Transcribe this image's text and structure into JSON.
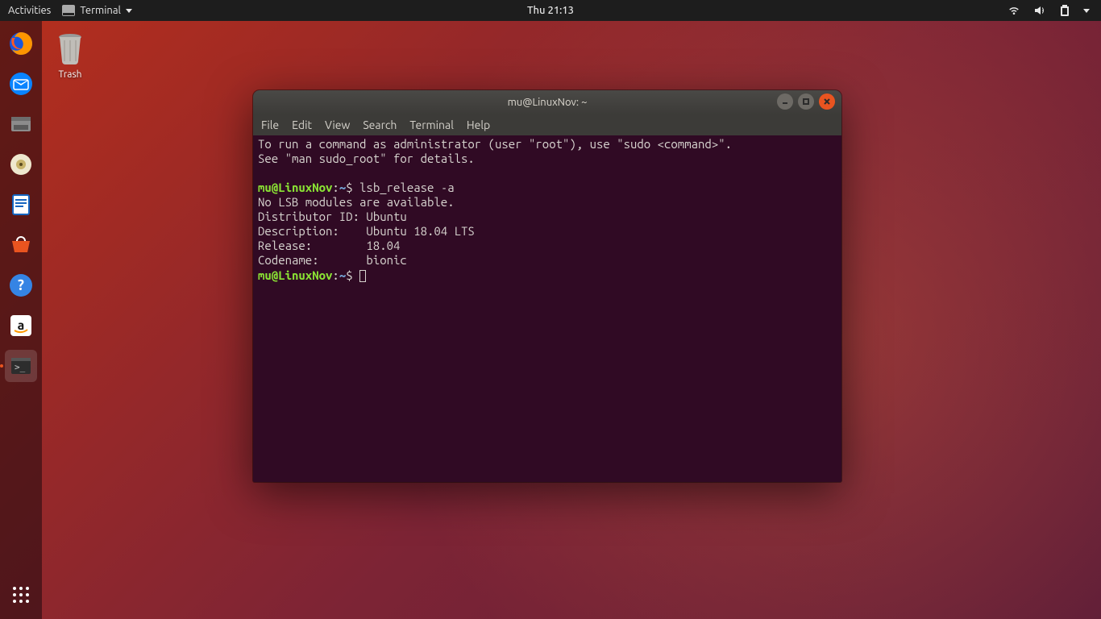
{
  "topbar": {
    "activities": "Activities",
    "app_label": "Terminal",
    "clock": "Thu 21:13"
  },
  "desktop": {
    "trash_label": "Trash"
  },
  "window": {
    "title": "mu@LinuxNov: ~",
    "menu": {
      "file": "File",
      "edit": "Edit",
      "view": "View",
      "search": "Search",
      "terminal": "Terminal",
      "help": "Help"
    }
  },
  "terminal": {
    "line1": "To run a command as administrator (user \"root\"), use \"sudo <command>\".",
    "line2": "See \"man sudo_root\" for details.",
    "prompt_user": "mu@LinuxNov",
    "prompt_sep": ":",
    "prompt_path": "~",
    "prompt_dollar": "$ ",
    "cmd1": "lsb_release -a",
    "out1": "No LSB modules are available.",
    "out2": "Distributor ID:\tUbuntu",
    "out3": "Description:\tUbuntu 18.04 LTS",
    "out4": "Release:\t18.04",
    "out5": "Codename:\tbionic"
  }
}
